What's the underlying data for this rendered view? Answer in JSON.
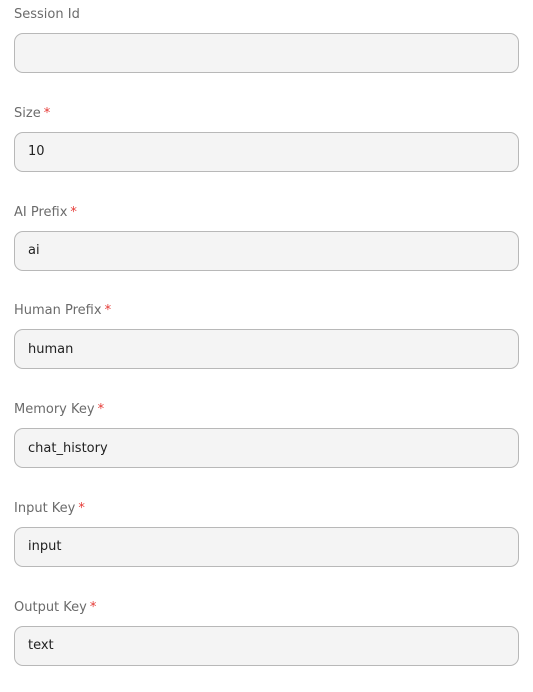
{
  "form": {
    "fields": [
      {
        "label": "Session Id",
        "required": false,
        "required_mark": "",
        "value": ""
      },
      {
        "label": "Size",
        "required": true,
        "required_mark": "*",
        "value": "10"
      },
      {
        "label": "AI Prefix",
        "required": true,
        "required_mark": "*",
        "value": "ai"
      },
      {
        "label": "Human Prefix",
        "required": true,
        "required_mark": "*",
        "value": "human"
      },
      {
        "label": "Memory Key",
        "required": true,
        "required_mark": "*",
        "value": "chat_history"
      },
      {
        "label": "Input Key",
        "required": true,
        "required_mark": "*",
        "value": "input"
      },
      {
        "label": "Output Key",
        "required": true,
        "required_mark": "*",
        "value": "text"
      }
    ]
  },
  "colors": {
    "required_mark": "#e53935",
    "label_text": "#6b6b6b",
    "input_background": "#f4f4f4",
    "input_border": "#b8b8b8"
  }
}
